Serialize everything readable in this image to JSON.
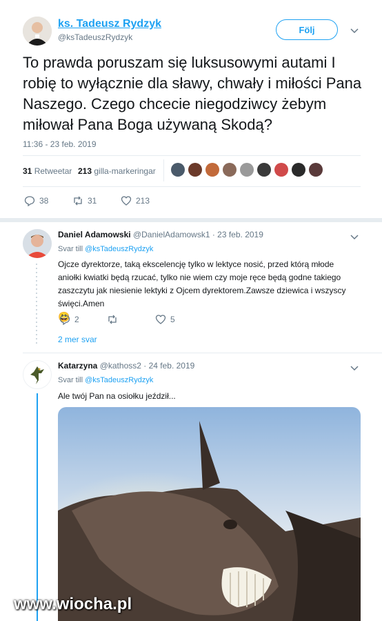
{
  "main_tweet": {
    "author_name": "ks. Tadeusz Rydzyk",
    "author_handle": "@ksTadeuszRydzyk",
    "follow_label": "Följ",
    "text": "To prawda poruszam się luksusowymi autami I robię to wyłącznie dla sławy, chwały i miłości Pana Naszego. Czego chcecie niegodziwcy żebym miłował Pana Boga używaną Skodą?",
    "timestamp": "11:36 - 23 feb. 2019",
    "retweets_count": "31",
    "retweets_label": "Retweetar",
    "likes_count": "213",
    "likes_label": "gilla-markeringar",
    "reply_count": "38",
    "retweet_count": "31",
    "like_count": "213"
  },
  "reply1": {
    "author_name": "Daniel Adamowski",
    "meta": "@DanielAdamowsk1 · 23 feb. 2019",
    "reply_to_prefix": "Svar till",
    "reply_to_handle": "@ksTadeuszRydzyk",
    "text": "Ojcze dyrektorze, taką ekscelencję tylko w lektyce nosić, przed którą młode aniołki kwiatki będą rzucać, tylko nie wiem czy moje ręce będą godne takiego zaszczytu jak niesienie lektyki z Ojcem dyrektorem.Zawsze dziewica i wszyscy święci.Amen",
    "emoji": "😃",
    "reply_count": "2",
    "like_count": "5",
    "more_replies": "2 mer svar"
  },
  "reply2": {
    "author_name": "Katarzyna",
    "meta": "@kathoss2 · 24 feb. 2019",
    "reply_to_prefix": "Svar till",
    "reply_to_handle": "@ksTadeuszRydzyk",
    "text": "Ale twój Pan na osiołku jeździł..."
  },
  "watermark": "www.wiocha.pl",
  "colors": {
    "accent": "#1da1f2",
    "muted": "#657786",
    "divider": "#e6ecf0"
  },
  "icons": [
    "chevron-down-icon",
    "reply-icon",
    "retweet-icon",
    "heart-icon"
  ]
}
